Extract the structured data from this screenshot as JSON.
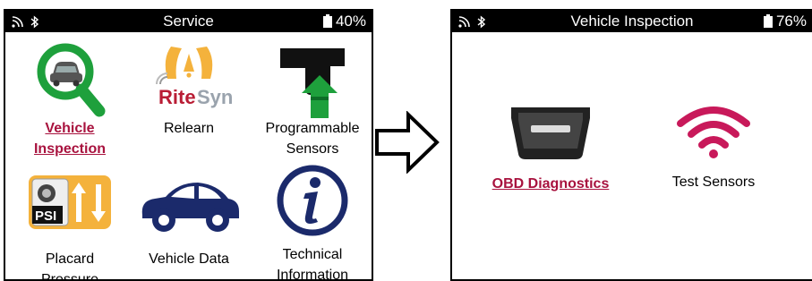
{
  "left_screen": {
    "title": "Service",
    "battery": "40%",
    "tiles": [
      {
        "label": "Vehicle Inspection",
        "selected": true,
        "icon": "magnifier-car-icon"
      },
      {
        "label": "Relearn",
        "selected": false,
        "icon": "ritesync-logo-icon",
        "logo_text": "RiteSync"
      },
      {
        "label": "Programmable Sensors",
        "selected": false,
        "icon": "sensor-program-icon"
      },
      {
        "label": "Placard Pressure",
        "selected": false,
        "icon": "psi-placard-icon",
        "logo_text": "PSI"
      },
      {
        "label": "Vehicle Data",
        "selected": false,
        "icon": "car-icon"
      },
      {
        "label": "Technical Information",
        "selected": false,
        "icon": "info-icon"
      }
    ]
  },
  "right_screen": {
    "title": "Vehicle Inspection",
    "battery": "76%",
    "tiles": [
      {
        "label": "OBD Diagnostics",
        "selected": true,
        "icon": "obd-connector-icon"
      },
      {
        "label": "Test Sensors",
        "selected": false,
        "icon": "wifi-signal-icon"
      }
    ]
  },
  "colors": {
    "accent": "#a8123e",
    "green": "#1ea03c",
    "navy": "#1b2a6b",
    "orange": "#f4b23c"
  }
}
